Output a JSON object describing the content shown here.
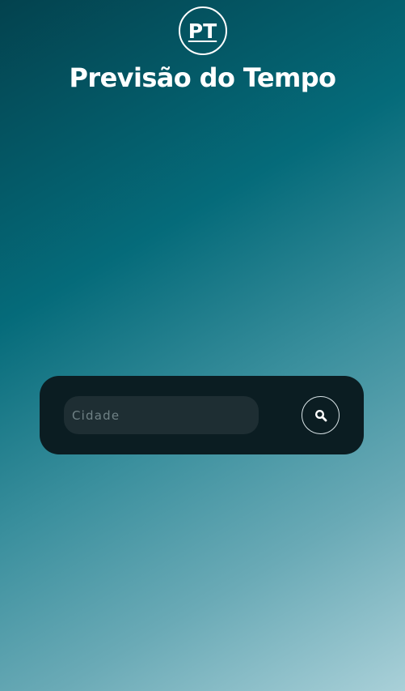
{
  "header": {
    "logo_text": "PT",
    "title": "Previsão do Tempo"
  },
  "search": {
    "placeholder": "Cidade",
    "value": "",
    "button_icon": "search-icon"
  },
  "colors": {
    "card_background": "#0b1d22",
    "input_background": "#1e2e33",
    "text": "#ffffff"
  }
}
